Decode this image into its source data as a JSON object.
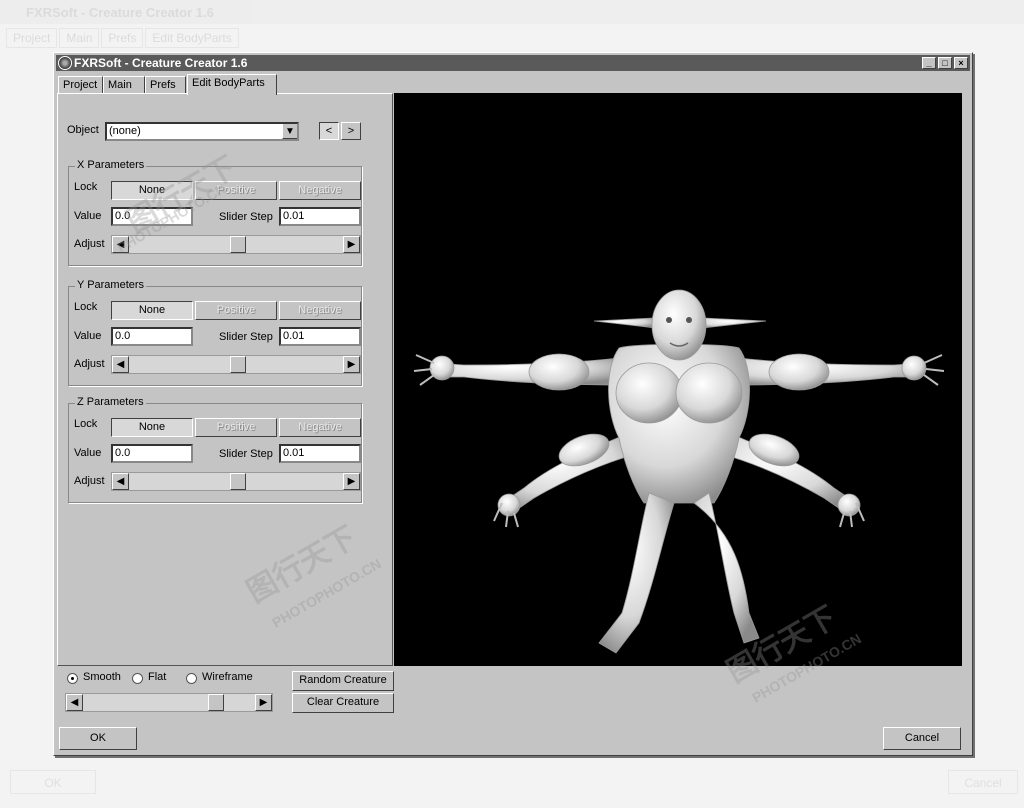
{
  "background_window": {
    "title": "FXRSoft - Creature Creator 1.6",
    "tabs": [
      "Project",
      "Main",
      "Prefs",
      "Edit BodyParts"
    ],
    "ok_label": "OK",
    "cancel_label": "Cancel"
  },
  "window": {
    "title": "FXRSoft - Creature Creator 1.6",
    "controls": {
      "minimize": "_",
      "maximize": "□",
      "close": "×"
    }
  },
  "tabs": [
    {
      "label": "Project"
    },
    {
      "label": "Main"
    },
    {
      "label": "Prefs"
    },
    {
      "label": "Edit BodyParts",
      "active": true
    }
  ],
  "object": {
    "label": "Object",
    "selected": "(none)",
    "prev_label": "<",
    "next_label": ">"
  },
  "x_params": {
    "title": "X Parameters",
    "lock_label": "Lock",
    "lock_options": [
      "None",
      "Positive",
      "Negative"
    ],
    "lock_selected": "None",
    "value_label": "Value",
    "value": "0.0",
    "step_label": "Slider Step",
    "step": "0.01",
    "adjust_label": "Adjust"
  },
  "y_params": {
    "title": "Y Parameters",
    "lock_label": "Lock",
    "lock_options": [
      "None",
      "Positive",
      "Negative"
    ],
    "lock_selected": "None",
    "value_label": "Value",
    "value": "0.0",
    "step_label": "Slider Step",
    "step": "0.01",
    "adjust_label": "Adjust"
  },
  "z_params": {
    "title": "Z Parameters",
    "lock_label": "Lock",
    "lock_options": [
      "None",
      "Positive",
      "Negative"
    ],
    "lock_selected": "None",
    "value_label": "Value",
    "value": "0.0",
    "step_label": "Slider Step",
    "step": "0.01",
    "adjust_label": "Adjust"
  },
  "render_mode": {
    "options": [
      "Smooth",
      "Flat",
      "Wireframe"
    ],
    "selected": "Smooth"
  },
  "buttons": {
    "random": "Random Creature",
    "clear": "Clear Creature",
    "ok": "OK",
    "cancel": "Cancel"
  },
  "watermark": {
    "logo": "图行天下",
    "site": "PHOTOPHOTO.CN"
  },
  "colors": {
    "window_bg": "#c4c4c4",
    "titlebar": "#5a5a5a",
    "viewport": "#000000",
    "creature": "#e6e6e6"
  }
}
